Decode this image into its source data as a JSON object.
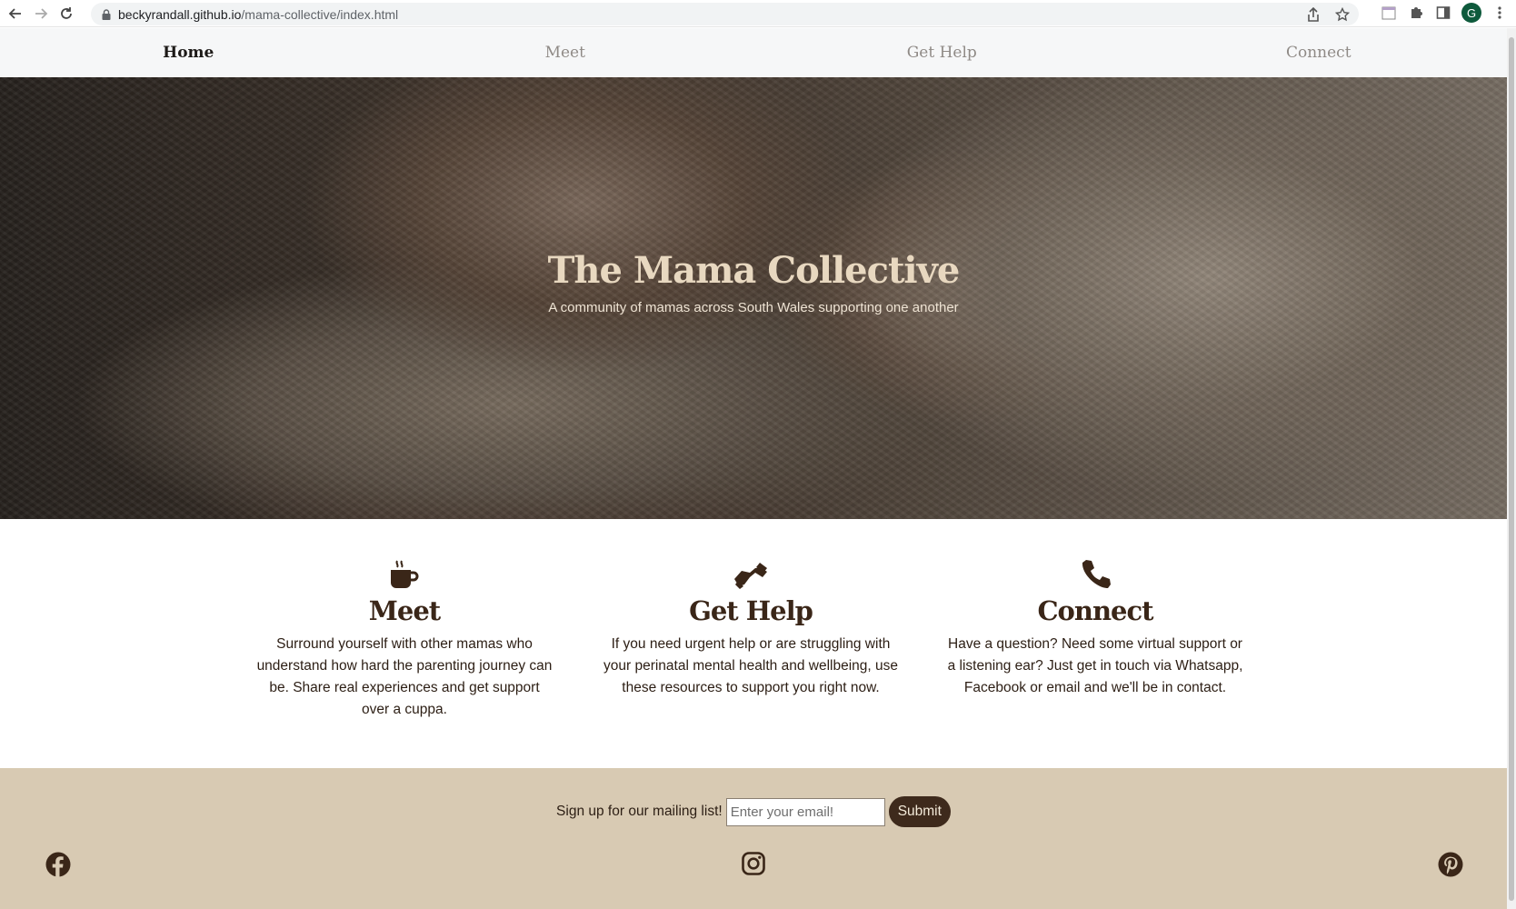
{
  "browser": {
    "url_host": "beckyrandall.github.io",
    "url_path": "/mama-collective/index.html",
    "profile_initial": "G"
  },
  "nav": {
    "items": [
      {
        "label": "Home",
        "active": true
      },
      {
        "label": "Meet",
        "active": false
      },
      {
        "label": "Get Help",
        "active": false
      },
      {
        "label": "Connect",
        "active": false
      }
    ]
  },
  "hero": {
    "title": "The Mama Collective",
    "subtitle": "A community of mamas across South Wales supporting one another"
  },
  "features": [
    {
      "icon": "coffee-mug-icon",
      "title": "Meet",
      "text": "Surround yourself with other mamas who understand how hard the parenting journey can be. Share real experiences and get support over a cuppa."
    },
    {
      "icon": "handshake-icon",
      "title": "Get Help",
      "text": "If you need urgent help or are struggling with your perinatal mental health and wellbeing, use these resources to support you right now."
    },
    {
      "icon": "phone-icon",
      "title": "Connect",
      "text": "Have a question? Need some virtual support or a listening ear? Just get in touch via Whatsapp, Facebook or email and we'll be in contact."
    }
  ],
  "footer": {
    "signup_label": "Sign up for our mailing list!",
    "email_placeholder": "Enter your email!",
    "submit_label": "Submit",
    "social": [
      "facebook-icon",
      "instagram-icon",
      "pinterest-icon"
    ]
  },
  "colors": {
    "brand_dark": "#3e2a1c",
    "footer_bg": "#d8cab3",
    "hero_title": "#e8d8c0"
  }
}
